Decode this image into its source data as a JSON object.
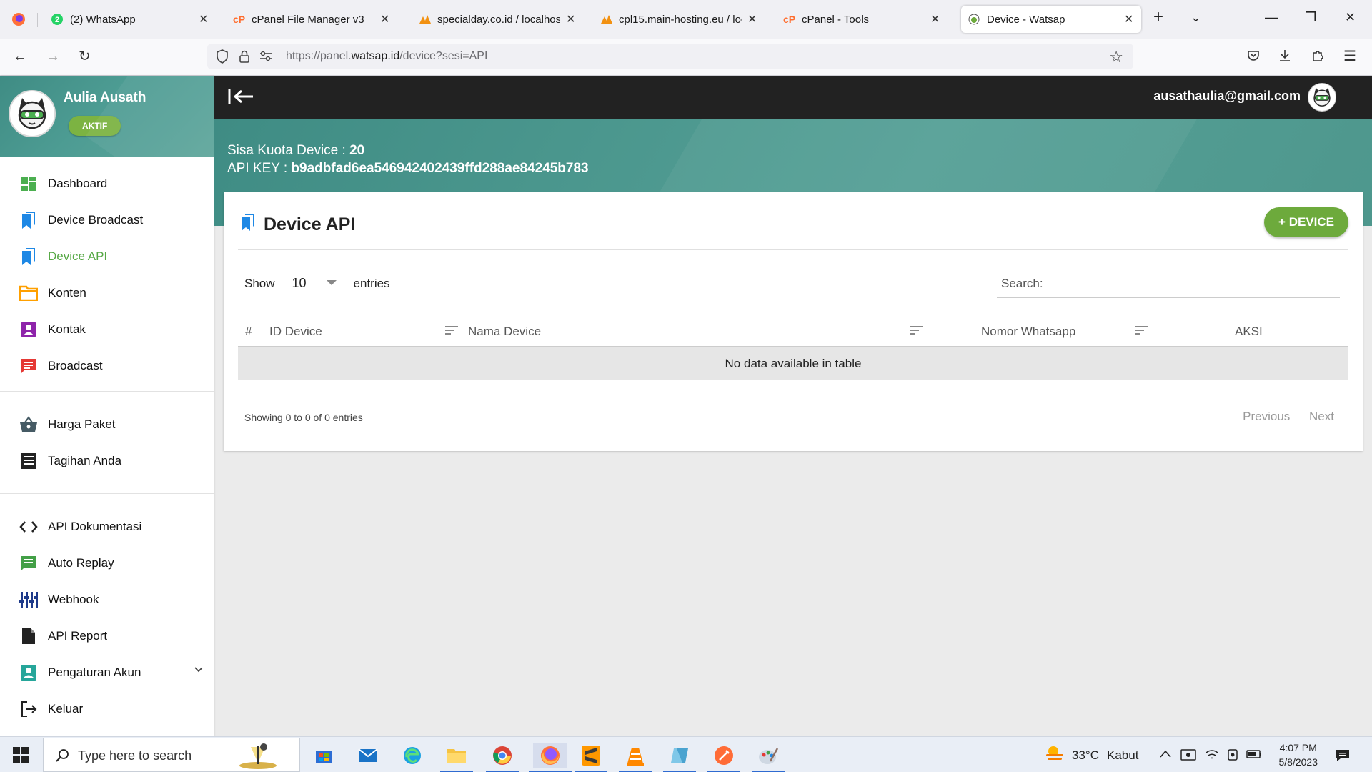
{
  "browser": {
    "tabs": [
      {
        "title": "(2) WhatsApp"
      },
      {
        "title": "cPanel File Manager v3"
      },
      {
        "title": "specialday.co.id / localhost"
      },
      {
        "title": "cpl15.main-hosting.eu / loca"
      },
      {
        "title": "cPanel - Tools"
      },
      {
        "title": "Device - Watsap"
      }
    ],
    "url_prefix": "https://panel.",
    "url_domain": "watsap.id",
    "url_path": "/device?sesi=API",
    "whatsapp_badge": "2"
  },
  "sidebar": {
    "user_name": "Aulia Ausath",
    "status_badge": "AKTIF",
    "group1": [
      {
        "label": "Dashboard",
        "icon": "dashboard-icon",
        "color": "#4caf50"
      },
      {
        "label": "Device Broadcast",
        "icon": "bookmarks-icon",
        "color": "#1e88e5"
      },
      {
        "label": "Device API",
        "icon": "bookmarks-icon",
        "color": "#1e88e5"
      },
      {
        "label": "Konten",
        "icon": "folder-icon",
        "color": "#ffa000"
      },
      {
        "label": "Kontak",
        "icon": "contact-icon",
        "color": "#8e24aa"
      },
      {
        "label": "Broadcast",
        "icon": "chat-icon",
        "color": "#e53935"
      }
    ],
    "group2": [
      {
        "label": "Harga Paket",
        "icon": "basket-icon",
        "color": "#455a64"
      },
      {
        "label": "Tagihan Anda",
        "icon": "receipt-icon",
        "color": "#222222"
      }
    ],
    "group3": [
      {
        "label": "API Dokumentasi",
        "icon": "code-icon",
        "color": "#222222"
      },
      {
        "label": "Auto Replay",
        "icon": "message-icon",
        "color": "#43a047"
      },
      {
        "label": "Webhook",
        "icon": "tune-icon",
        "color": "#1e3a8a"
      },
      {
        "label": "API Report",
        "icon": "file-icon",
        "color": "#222222"
      },
      {
        "label": "Pengaturan Akun",
        "icon": "account-box-icon",
        "color": "#26a69a"
      },
      {
        "label": "Keluar",
        "icon": "logout-icon",
        "color": "#222222"
      }
    ],
    "active_item": "Device API"
  },
  "topbar": {
    "email": "ausathaulia@gmail.com"
  },
  "banner": {
    "quota_label": "Sisa Kuota Device : ",
    "quota_value": "20",
    "api_key_label": "API KEY : ",
    "api_key_value": "b9adbfad6ea546942402439ffd288ae84245b783"
  },
  "card": {
    "title": "Device API",
    "add_button": "+ DEVICE",
    "show_label": "Show",
    "entries_value": "10",
    "entries_label": "entries",
    "search_label": "Search:",
    "columns": [
      "#",
      "ID Device",
      "Nama Device",
      "Nomor Whatsapp",
      "AKSI"
    ],
    "empty_message": "No data available in table",
    "info": "Showing 0 to 0 of 0 entries",
    "prev": "Previous",
    "next": "Next"
  },
  "taskbar": {
    "search_placeholder": "Type here to search",
    "weather_temp": "33°C",
    "weather_desc": "Kabut",
    "time": "4:07 PM",
    "date": "5/8/2023"
  },
  "colors": {
    "accent_green": "#6daa3c",
    "active_menu": "#56a845",
    "header_teal": "#4d9c93",
    "topbar_dark": "#222222"
  }
}
